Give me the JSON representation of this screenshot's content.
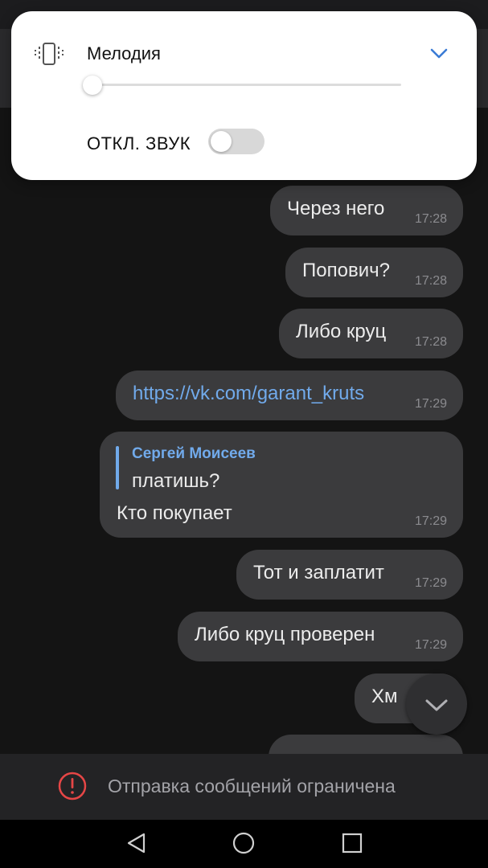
{
  "volume_panel": {
    "title": "Мелодия",
    "level_fraction": 0.0,
    "mute_label": "ОТКЛ. ЗВУК",
    "mute_on": false,
    "icons": {
      "mode": "vibrate-icon",
      "expand": "chevron-down-icon"
    }
  },
  "messages": [
    {
      "text": "Через него",
      "time": "17:28"
    },
    {
      "text": "Попович?",
      "time": "17:28"
    },
    {
      "text": "Либо круц",
      "time": "17:28"
    },
    {
      "text": "https://vk.com/garant_kruts",
      "time": "17:29"
    },
    {
      "reply_name": "Сергей Моисеев",
      "reply_text": "платишь?",
      "text": "Кто покупает",
      "time": "17:29"
    },
    {
      "text": "Тот и заплатит",
      "time": "17:29"
    },
    {
      "text": "Либо круц проверен",
      "time": "17:29"
    },
    {
      "text": "Хм"
    }
  ],
  "footer": {
    "text": "Отправка сообщений ограничена"
  },
  "colors": {
    "bubble": "#3b3b3d",
    "link": "#71aaeb",
    "warning": "#e64646",
    "accent": "#3a7bd5"
  }
}
